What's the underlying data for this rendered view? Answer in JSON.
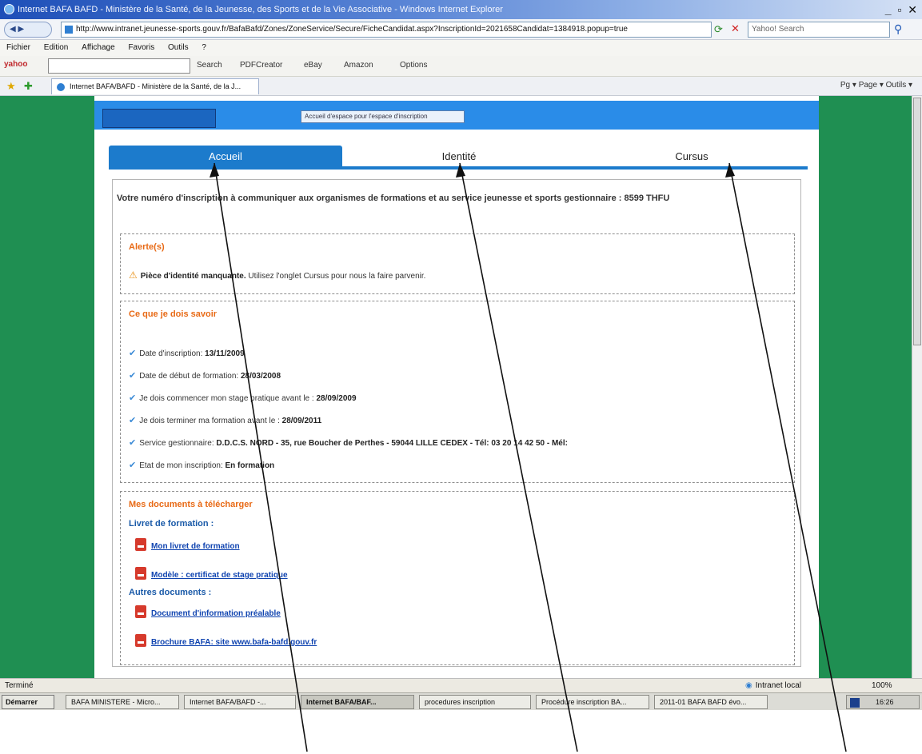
{
  "browser": {
    "window_title": "Internet BAFA BAFD - Ministère de la Santé, de la Jeunesse, des Sports et de la Vie Associative - Windows Internet Explorer",
    "back_label": "",
    "url": "http://www.intranet.jeunesse-sports.gouv.fr/BafaBafd/Zones/ZoneService/Secure/FicheCandidat.aspx?InscriptionId=2021658Candidat=1384918.popup=true",
    "search_placeholder": "Yahoo! Search",
    "menu": [
      "Fichier",
      "Edition",
      "Affichage",
      "Favoris",
      "Outils",
      "?"
    ],
    "toolbar": {
      "logo": "yahoo",
      "search": "Search",
      "pdfcreator": "PDFCreator",
      "ebay": "eBay",
      "amazon": "Amazon",
      "options": "Options"
    },
    "tab_title": "Internet BAFA/BAFD - Ministère de la Santé, de la J...",
    "command_bar": "Pg ▾  Page ▾  Outils ▾"
  },
  "page": {
    "header_select": "Accueil d'espace pour l'espace d'inscription",
    "tabs": [
      {
        "label": "Accueil",
        "active": true
      },
      {
        "label": "Identité",
        "active": false
      },
      {
        "label": "Cursus",
        "active": false
      }
    ],
    "inscription_line": "Votre numéro d'inscription à communiquer aux organismes de formations et au service jeunesse et sports gestionnaire : 8599 THFU",
    "alerts": {
      "title": "Alerte(s)",
      "message_bold": "Pièce d'identité manquante.",
      "message_rest": " Utilisez l'onglet Cursus pour nous la faire parvenir."
    },
    "todo": {
      "title": "Ce que je dois savoir",
      "items": [
        {
          "label": "Date d'inscription: ",
          "value": "13/11/2009"
        },
        {
          "label": "Date de début de formation: ",
          "value": "28/03/2008"
        },
        {
          "label": "Je dois commencer mon stage pratique avant le : ",
          "value": "28/09/2009"
        },
        {
          "label": "Je dois terminer ma formation avant le : ",
          "value": "28/09/2011"
        },
        {
          "label": "Service gestionnaire: ",
          "value": "D.D.C.S. NORD - 35, rue Boucher de Perthes - 59044 LILLE CEDEX - Tél: 03 20 14 42 50 - Mél:"
        },
        {
          "label": "Etat de mon inscription: ",
          "value": "En formation"
        }
      ]
    },
    "documents": {
      "title": "Mes documents à télécharger",
      "section_livret": "Livret de formation :",
      "links_livret": [
        "Mon livret de formation",
        "Modèle : certificat de stage pratique"
      ],
      "section_autres": "Autres documents :",
      "links_autres": [
        "Document d'information préalable",
        "Brochure BAFA: site www.bafa-bafd.gouv.fr"
      ]
    }
  },
  "status": {
    "left": "Terminé",
    "zone": "Intranet local",
    "zoom": "100%"
  },
  "taskbar": {
    "start": "Démarrer",
    "buttons": [
      {
        "label": "BAFA MINISTERE - Micro...",
        "active": false
      },
      {
        "label": "Internet BAFA/BAFD -...",
        "active": false
      },
      {
        "label": "Internet BAFA/BAF...",
        "active": true
      },
      {
        "label": "procedures inscription",
        "active": false
      },
      {
        "label": "Procédure inscription BA...",
        "active": false
      },
      {
        "label": "2011-01 BAFA BAFD évo...",
        "active": false
      }
    ],
    "clock": "16:26"
  },
  "colors": {
    "page_background": "#1f8f52",
    "header_blue": "#2a8ce8",
    "tab_active": "#1c7bcc",
    "alert_title": "#e86a16",
    "link": "#1044b0"
  }
}
